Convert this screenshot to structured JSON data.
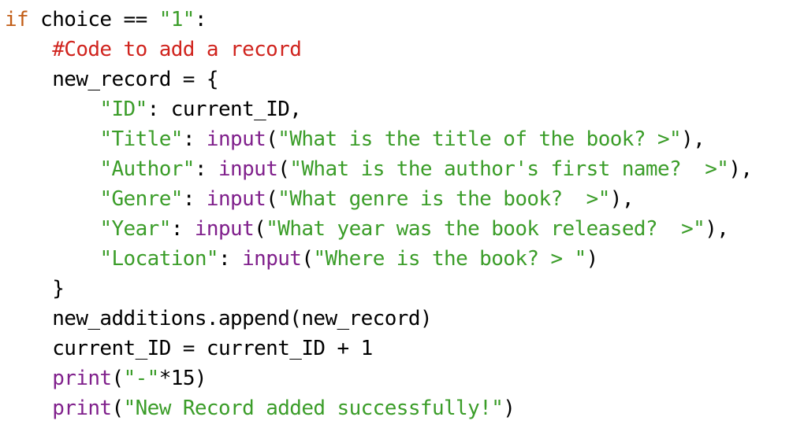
{
  "colors": {
    "keyword": "#c25d16",
    "comment": "#d0241e",
    "string": "#3b9d29",
    "builtin": "#80208c",
    "default": "#000000"
  },
  "code": {
    "lines": [
      {
        "tokens": [
          {
            "t": "if",
            "c": "keyword"
          },
          {
            "t": " choice == ",
            "c": "default"
          },
          {
            "t": "\"1\"",
            "c": "string"
          },
          {
            "t": ":",
            "c": "default"
          }
        ]
      },
      {
        "tokens": [
          {
            "t": "    ",
            "c": "default"
          },
          {
            "t": "#Code to add a record",
            "c": "comment"
          }
        ]
      },
      {
        "tokens": [
          {
            "t": "    new_record = {",
            "c": "default"
          }
        ]
      },
      {
        "tokens": [
          {
            "t": "        ",
            "c": "default"
          },
          {
            "t": "\"ID\"",
            "c": "string"
          },
          {
            "t": ": current_ID,",
            "c": "default"
          }
        ]
      },
      {
        "tokens": [
          {
            "t": "        ",
            "c": "default"
          },
          {
            "t": "\"Title\"",
            "c": "string"
          },
          {
            "t": ": ",
            "c": "default"
          },
          {
            "t": "input",
            "c": "builtin"
          },
          {
            "t": "(",
            "c": "default"
          },
          {
            "t": "\"What is the title of the book? >\"",
            "c": "string"
          },
          {
            "t": "),",
            "c": "default"
          }
        ]
      },
      {
        "tokens": [
          {
            "t": "        ",
            "c": "default"
          },
          {
            "t": "\"Author\"",
            "c": "string"
          },
          {
            "t": ": ",
            "c": "default"
          },
          {
            "t": "input",
            "c": "builtin"
          },
          {
            "t": "(",
            "c": "default"
          },
          {
            "t": "\"What is the author's first name?  >\"",
            "c": "string"
          },
          {
            "t": "),",
            "c": "default"
          }
        ]
      },
      {
        "tokens": [
          {
            "t": "        ",
            "c": "default"
          },
          {
            "t": "\"Genre\"",
            "c": "string"
          },
          {
            "t": ": ",
            "c": "default"
          },
          {
            "t": "input",
            "c": "builtin"
          },
          {
            "t": "(",
            "c": "default"
          },
          {
            "t": "\"What genre is the book?  >\"",
            "c": "string"
          },
          {
            "t": "),",
            "c": "default"
          }
        ]
      },
      {
        "tokens": [
          {
            "t": "        ",
            "c": "default"
          },
          {
            "t": "\"Year\"",
            "c": "string"
          },
          {
            "t": ": ",
            "c": "default"
          },
          {
            "t": "input",
            "c": "builtin"
          },
          {
            "t": "(",
            "c": "default"
          },
          {
            "t": "\"What year was the book released?  >\"",
            "c": "string"
          },
          {
            "t": "),",
            "c": "default"
          }
        ]
      },
      {
        "tokens": [
          {
            "t": "        ",
            "c": "default"
          },
          {
            "t": "\"Location\"",
            "c": "string"
          },
          {
            "t": ": ",
            "c": "default"
          },
          {
            "t": "input",
            "c": "builtin"
          },
          {
            "t": "(",
            "c": "default"
          },
          {
            "t": "\"Where is the book? > \"",
            "c": "string"
          },
          {
            "t": ")",
            "c": "default"
          }
        ]
      },
      {
        "tokens": [
          {
            "t": "    }",
            "c": "default"
          }
        ]
      },
      {
        "tokens": [
          {
            "t": "    new_additions.append(new_record)",
            "c": "default"
          }
        ]
      },
      {
        "tokens": [
          {
            "t": "    current_ID = current_ID + 1",
            "c": "default"
          }
        ]
      },
      {
        "tokens": [
          {
            "t": "    ",
            "c": "default"
          },
          {
            "t": "print",
            "c": "builtin"
          },
          {
            "t": "(",
            "c": "default"
          },
          {
            "t": "\"-\"",
            "c": "string"
          },
          {
            "t": "*15)",
            "c": "default"
          }
        ]
      },
      {
        "tokens": [
          {
            "t": "    ",
            "c": "default"
          },
          {
            "t": "print",
            "c": "builtin"
          },
          {
            "t": "(",
            "c": "default"
          },
          {
            "t": "\"New Record added successfully!\"",
            "c": "string"
          },
          {
            "t": ")",
            "c": "default"
          }
        ]
      }
    ]
  }
}
